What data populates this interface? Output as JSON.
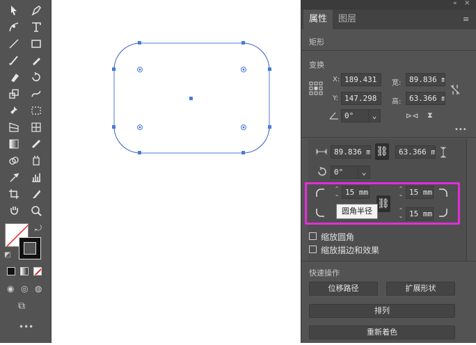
{
  "toolbar": {
    "tools": [
      "selection-tool",
      "direct-selection-tool",
      "curvature-tool",
      "pen-tool",
      "anchor-tool",
      "type-tool",
      "line-tool",
      "rectangle-tool",
      "paintbrush-tool",
      "pencil-tool",
      "eraser-tool",
      "rotate-tool",
      "scale-tool",
      "warp-tool",
      "pin-tool",
      "free-transform-tool",
      "perspective-tool",
      "mesh-tool",
      "gradient-tool",
      "blend-tool",
      "shape-builder-tool",
      "symbol-sprayer-tool",
      "eyedropper-tool",
      "graph-tool",
      "artboard-tool",
      "slice-tool",
      "hand-tool",
      "zoom-tool"
    ],
    "more": "•••"
  },
  "panel": {
    "tabs": [
      "属性",
      "图层"
    ],
    "object_type": "矩形",
    "transform_label": "变换",
    "x_label": "X:",
    "x_value": "189.431",
    "y_label": "Y:",
    "y_value": "147.298",
    "width_label": "宽:",
    "width_value": "89.836 m",
    "height_label": "高:",
    "height_value": "63.366 m",
    "rotate_value": "0°",
    "more": "•••",
    "rect_width": "89.836 mr",
    "rect_height": "63.366 mr",
    "rect_rotate": "0°",
    "corner_tl": "15 mm",
    "corner_tr": "15 mm",
    "corner_br": "15 mm",
    "tooltip": "圆角半径",
    "scale_corners": "缩放圆角",
    "scale_strokes": "缩放描边和效果",
    "quick_actions": "快速操作",
    "offset_path": "位移路径",
    "expand_shape": "扩展形状",
    "arrange": "排列",
    "recolor": "重新着色"
  },
  "colors": {
    "selection": "#4a7bd6",
    "highlight": "#e22ed9"
  }
}
